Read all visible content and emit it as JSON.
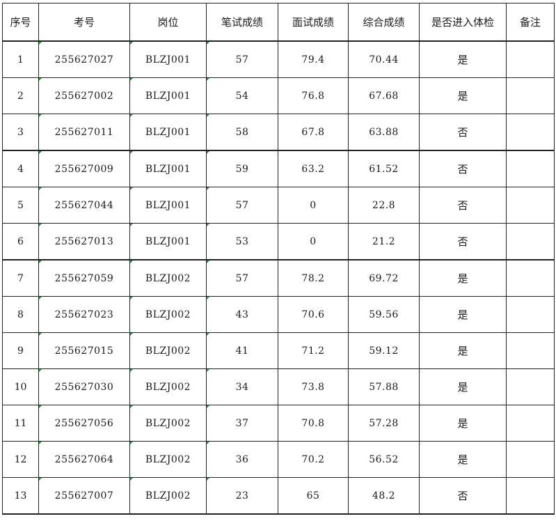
{
  "headers": [
    "序号",
    "考号",
    "岗位",
    "笔试成绩",
    "面试成绩",
    "综合成绩",
    "是否进入体检",
    "备注"
  ],
  "rows": [
    [
      "1",
      "255627027",
      "BLZJ001",
      "57",
      "79.4",
      "70.44",
      "是",
      ""
    ],
    [
      "2",
      "255627002",
      "BLZJ001",
      "54",
      "76.8",
      "67.68",
      "是",
      ""
    ],
    [
      "3",
      "255627011",
      "BLZJ001",
      "58",
      "67.8",
      "63.88",
      "否",
      ""
    ],
    [
      "4",
      "255627009",
      "BLZJ001",
      "59",
      "63.2",
      "61.52",
      "否",
      ""
    ],
    [
      "5",
      "255627044",
      "BLZJ001",
      "57",
      "0",
      "22.8",
      "否",
      ""
    ],
    [
      "6",
      "255627013",
      "BLZJ001",
      "53",
      "0",
      "21.2",
      "否",
      ""
    ],
    [
      "7",
      "255627059",
      "BLZJ002",
      "57",
      "78.2",
      "69.72",
      "是",
      ""
    ],
    [
      "8",
      "255627023",
      "BLZJ002",
      "43",
      "70.6",
      "59.56",
      "是",
      ""
    ],
    [
      "9",
      "255627015",
      "BLZJ002",
      "41",
      "71.2",
      "59.12",
      "是",
      ""
    ],
    [
      "10",
      "255627030",
      "BLZJ002",
      "34",
      "73.8",
      "57.88",
      "是",
      ""
    ],
    [
      "11",
      "255627056",
      "BLZJ002",
      "37",
      "70.8",
      "57.28",
      "是",
      ""
    ],
    [
      "12",
      "255627064",
      "BLZJ002",
      "36",
      "70.2",
      "56.52",
      "是",
      ""
    ],
    [
      "13",
      "255627007",
      "BLZJ002",
      "23",
      "65",
      "48.2",
      "否",
      ""
    ]
  ]
}
